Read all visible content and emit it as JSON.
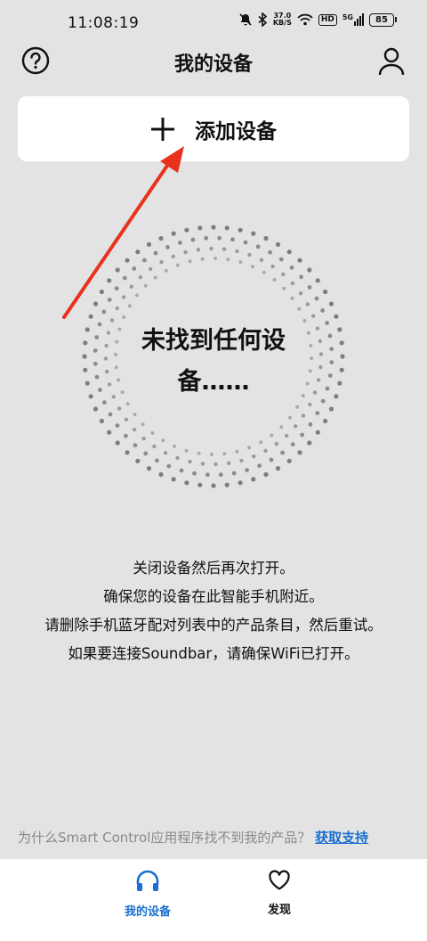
{
  "status_bar": {
    "time": "11:08:19",
    "net_speed_value": "37.0",
    "net_speed_unit": "KB/S",
    "hd_badge": "HD",
    "signal_label": "5G",
    "battery": "85",
    "icons": [
      "mute-icon",
      "bluetooth-icon",
      "wifi-icon",
      "signal-icon",
      "battery-icon"
    ]
  },
  "header": {
    "title": "我的设备",
    "left_icon": "help-icon",
    "right_icon": "account-icon"
  },
  "add_device": {
    "label": "添加设备",
    "icon": "plus-icon"
  },
  "empty_state": {
    "message": "未找到任何设备……"
  },
  "instructions": [
    "关闭设备然后再次打开。",
    "确保您的设备在此智能手机附近。",
    "请删除手机蓝牙配对列表中的产品条目，然后重试。",
    "如果要连接Soundbar，请确保WiFi已打开。"
  ],
  "help_footer": {
    "question": "为什么Smart Control应用程序找不到我的产品？",
    "link": "获取支持"
  },
  "bottom_nav": [
    {
      "label": "我的设备",
      "icon": "headphones-icon",
      "active": true
    },
    {
      "label": "发现",
      "icon": "heart-icon",
      "active": false
    }
  ],
  "colors": {
    "background": "#e3e3e3",
    "card": "#ffffff",
    "accent": "#1a6fd1",
    "annotation_arrow": "#e8321e"
  }
}
